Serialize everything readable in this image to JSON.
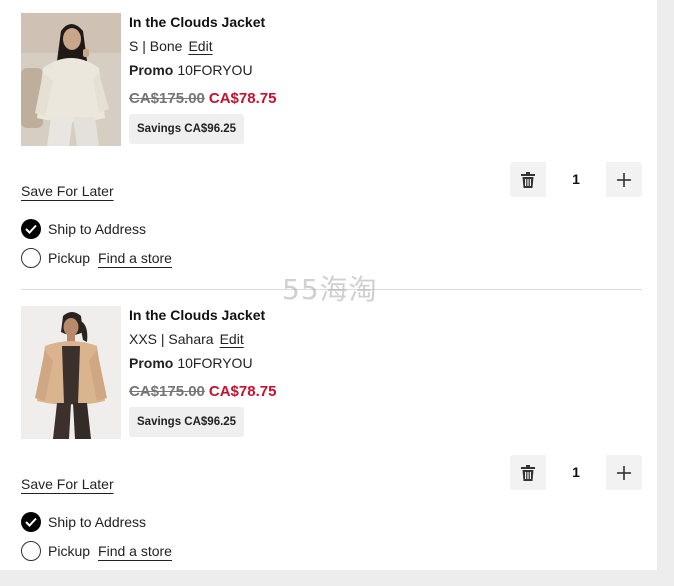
{
  "items": [
    {
      "title": "In the Clouds Jacket",
      "variant": "S | Bone",
      "edit_label": "Edit",
      "promo_label": "Promo",
      "promo_code": "10FORYOU",
      "original_price": "CA$175.00",
      "sale_price": "CA$78.75",
      "savings": "Savings CA$96.25",
      "quantity": "1",
      "save_for_later": "Save For Later",
      "ship_label": "Ship to Address",
      "pickup_label": "Pickup",
      "find_store_label": "Find a store",
      "ship_selected": true,
      "image_colors": {
        "jacket": "#ece7dc",
        "bg": "#d6cdc3",
        "hair": "#1f1a17"
      }
    },
    {
      "title": "In the Clouds Jacket",
      "variant": "XXS | Sahara",
      "edit_label": "Edit",
      "promo_label": "Promo",
      "promo_code": "10FORYOU",
      "original_price": "CA$175.00",
      "sale_price": "CA$78.75",
      "savings": "Savings CA$96.25",
      "quantity": "1",
      "save_for_later": "Save For Later",
      "ship_label": "Ship to Address",
      "pickup_label": "Pickup",
      "find_store_label": "Find a store",
      "ship_selected": true,
      "image_colors": {
        "jacket": "#d9b48f",
        "bg": "#f0eeec",
        "hair": "#2a2420"
      }
    }
  ],
  "watermark": "55海淘",
  "colors": {
    "sale": "#c8102e",
    "strike": "#767676",
    "chip": "#efefef"
  }
}
